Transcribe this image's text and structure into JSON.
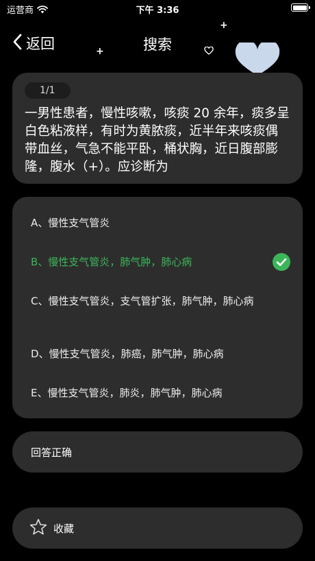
{
  "status_bar": {
    "carrier": "运营商",
    "time": "下午 3:36"
  },
  "nav": {
    "back_label": "返回",
    "title": "搜索"
  },
  "question": {
    "counter": "1/1",
    "text": "一男性患者，慢性咳嗽，咳痰 20 余年，痰多呈白色粘液样，有时为黄脓痰，近半年来咳痰偶带血丝，气急不能平卧，桶状胸，近日腹部膨隆，腹水（+）。应诊断为"
  },
  "options": [
    {
      "label": "A、慢性支气管炎",
      "correct": false
    },
    {
      "label": "B、慢性支气管炎，肺气肿，肺心病",
      "correct": true
    },
    {
      "label": "C、慢性支气管炎，支气管扩张，肺气肿，肺心病",
      "correct": false
    },
    {
      "label": "D、慢性支气管炎，肺癌，肺气肿，肺心病",
      "correct": false
    },
    {
      "label": "E、慢性支气管炎，肺炎，肺气肿，肺心病",
      "correct": false
    }
  ],
  "result": {
    "text": "回答正确"
  },
  "favorite": {
    "label": "收藏",
    "icon": "star-outline-icon"
  },
  "colors": {
    "background": "#000000",
    "card": "#2d2d2d",
    "correct": "#3cb55a",
    "heart": "#c9d8ea"
  }
}
